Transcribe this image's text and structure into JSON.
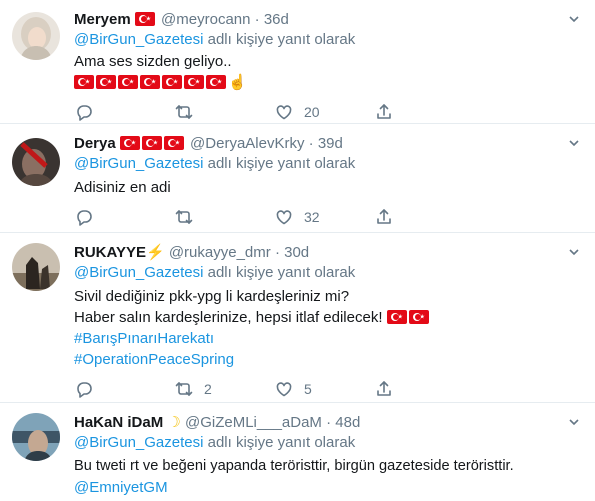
{
  "tweets": [
    {
      "name": "Meryem",
      "handle": "@meyrocann",
      "time": "36d",
      "reply_prefix": "@BirGun_Gazetesi",
      "reply_suffix": " adlı kişiye yanıt olarak",
      "lines": [
        "Ama ses sizden geliyo.."
      ],
      "reply_count": "",
      "retweet_count": "",
      "like_count": "20"
    },
    {
      "name": "Derya",
      "handle": "@DeryaAlevKrky",
      "time": "39d",
      "reply_prefix": "@BirGun_Gazetesi",
      "reply_suffix": " adlı kişiye yanıt olarak",
      "lines": [
        "Adisiniz en adi"
      ],
      "reply_count": "",
      "retweet_count": "",
      "like_count": "32"
    },
    {
      "name": "RUKAYYE",
      "handle": "@rukayye_dmr",
      "time": "30d",
      "reply_prefix": "@BirGun_Gazetesi",
      "reply_suffix": " adlı kişiye yanıt olarak",
      "lines": [
        "Sivil dediğiniz pkk-ypg li kardeşleriniz mi?",
        "Haber salın kardeşlerinize, hepsi itlaf edilecek!"
      ],
      "hashtags": [
        "#BarışPınarıHarekatı",
        "#OperationPeaceSpring"
      ],
      "reply_count": "",
      "retweet_count": "2",
      "like_count": "5"
    },
    {
      "name": "HaKaN iDaM",
      "handle": "@GiZeMLi___aDaM",
      "time": "48d",
      "reply_prefix": "@BirGun_Gazetesi",
      "reply_suffix": " adlı kişiye yanıt olarak",
      "lines": [
        "Bu tweti rt ve beğeni yapanda teröristtir, birgün gazeteside teröristtir."
      ],
      "mention_line": "@EmniyetGM"
    }
  ],
  "dot": "·",
  "colors": {
    "link": "#1b95e0",
    "muted": "#657786",
    "flag_red": "#e30a17"
  }
}
